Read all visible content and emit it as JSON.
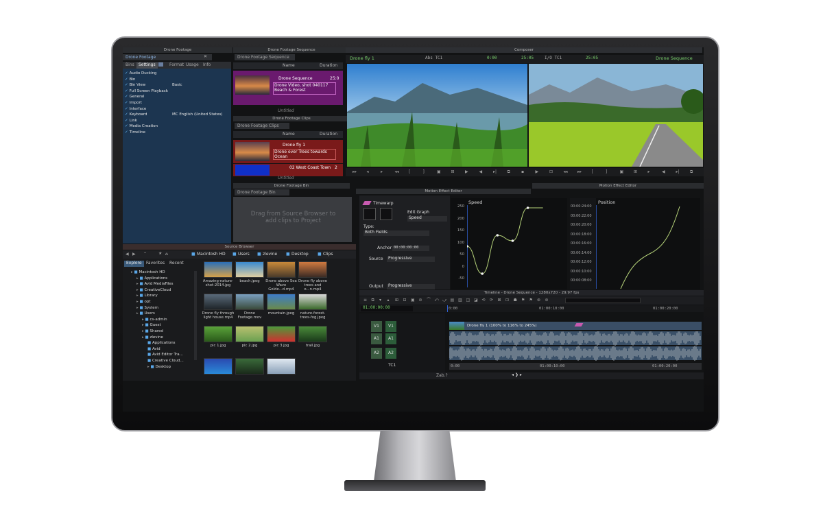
{
  "colors": {
    "bin_blue": "#1c3550",
    "purple_row": "#6a1a6e",
    "red_row": "#7a1a1a",
    "green_tc": "#7bd36e",
    "curve": "#b6d37a",
    "track_green": "#2f6a3e"
  },
  "bin_panel": {
    "window_title": "Drone Footage",
    "tab_label": "Drone Footage",
    "subtabs": [
      "Bins",
      "Settings",
      "",
      "Format",
      "Usage",
      "Info"
    ],
    "settings": [
      {
        "name": "Audio Ducking",
        "value": ""
      },
      {
        "name": "Bin",
        "value": ""
      },
      {
        "name": "Bin View",
        "value": "Basic"
      },
      {
        "name": "Full Screen Playback",
        "value": ""
      },
      {
        "name": "General",
        "value": ""
      },
      {
        "name": "Import",
        "value": ""
      },
      {
        "name": "Interface",
        "value": ""
      },
      {
        "name": "Keyboard",
        "value": "MC English (United States)"
      },
      {
        "name": "Link",
        "value": ""
      },
      {
        "name": "Media Creation",
        "value": ""
      },
      {
        "name": "Timeline",
        "value": ""
      }
    ]
  },
  "sequence_bin": {
    "window_title": "Drone Footage Sequence",
    "tab_label": "Drone Footage Sequence",
    "col_name": "Name",
    "col_duration": "Duration",
    "item_name": "Drone Sequence",
    "item_duration": "25:0",
    "item_comment": "Drone Video, shot 040117 Beach & Forest",
    "footer": "Untitled"
  },
  "clips_bin": {
    "window_title": "Drone Footage Clips",
    "tab_label": "Drone Footage Clips",
    "col_name": "Name",
    "col_duration": "Duration",
    "item1_name": "Drone fly 1",
    "item1_comment": "Drone over Trees towards Ocean",
    "item2_name": "02 West Coast Town",
    "item2_duration": "2",
    "footer": "Untitled"
  },
  "footage_bin": {
    "window_title": "Drone Footage Bin",
    "tab_label": "Drone Footage Bin",
    "empty_text": "Drag from Source Browser to add clips to Project"
  },
  "composer": {
    "title": "Composer",
    "source_clip": "Drone fly 1",
    "abs_label": "Abs TC1",
    "abs_value": "0:00",
    "dur1": "25:05",
    "io_label": "I/O TC1",
    "dur2": "25:05",
    "record_seq": "Drone Sequence"
  },
  "source_browser": {
    "title": "Source Browser",
    "path": [
      "Macintosh HD",
      "Users",
      "zlevine",
      "Desktop",
      "Clips"
    ],
    "tabs": [
      "Explore",
      "Favorites",
      "Recent"
    ],
    "tree": [
      {
        "name": "Macintosh HD",
        "level": 0
      },
      {
        "name": "Applications",
        "level": 1
      },
      {
        "name": "Avid MediaFiles",
        "level": 1
      },
      {
        "name": "CreativeCloud",
        "level": 1
      },
      {
        "name": "Library",
        "level": 1
      },
      {
        "name": "opt",
        "level": 1
      },
      {
        "name": "System",
        "level": 1
      },
      {
        "name": "Users",
        "level": 1
      },
      {
        "name": "cs-admin",
        "level": 2
      },
      {
        "name": "Guest",
        "level": 2
      },
      {
        "name": "Shared",
        "level": 2
      },
      {
        "name": "zlevine",
        "level": 2
      },
      {
        "name": "Applications",
        "level": 3
      },
      {
        "name": "Avid",
        "level": 3
      },
      {
        "name": "Avid Editor Tra...",
        "level": 3
      },
      {
        "name": "Creative Cloud...",
        "level": 3
      },
      {
        "name": "Desktop",
        "level": 3
      }
    ],
    "files": [
      {
        "name": "Amazing-nature-shot-2014.jpg",
        "c1": "#2a6fb8",
        "c2": "#d6a24a"
      },
      {
        "name": "beach.jpeg",
        "c1": "#3a8ad0",
        "c2": "#e0cfa0"
      },
      {
        "name": "Drone above Sea Wave Golde...d.mp4",
        "c1": "#c98a3a",
        "c2": "#4a3a2a"
      },
      {
        "name": "Drone fly above trees and o...n.mp4",
        "c1": "#d07a40",
        "c2": "#3b2a24"
      },
      {
        "name": "Drone fly through light house.mp4",
        "c1": "#5a6a7a",
        "c2": "#1e2428"
      },
      {
        "name": "Drone Footage.mov",
        "c1": "#7aa0c0",
        "c2": "#3a4a3a"
      },
      {
        "name": "mountain.jpeg",
        "c1": "#3d7cc9",
        "c2": "#6a8a4a"
      },
      {
        "name": "nature-forest-trees-fog.jpeg",
        "c1": "#d8d8d8",
        "c2": "#3a6a2a"
      },
      {
        "name": "pic 1.jpg",
        "c1": "#5aa23a",
        "c2": "#2a5a1a"
      },
      {
        "name": "pic 2.jpg",
        "c1": "#b8c070",
        "c2": "#6aa050"
      },
      {
        "name": "pic 3.jpg",
        "c1": "#4a9a3a",
        "c2": "#d03030"
      },
      {
        "name": "trail.jpg",
        "c1": "#4a8a3a",
        "c2": "#1a3a1a"
      },
      {
        "name": "",
        "c1": "#2a4ab0",
        "c2": "#2a8ad8"
      },
      {
        "name": "",
        "c1": "#3a6a3a",
        "c2": "#1a2a1a"
      },
      {
        "name": "",
        "c1": "#e0e8f0",
        "c2": "#8aa0b8"
      }
    ]
  },
  "motion_effect": {
    "title1": "Motion Effect Editor",
    "title2": "Motion Effect Editor",
    "timewarp": "Timewarp",
    "edit_graph": "Edit Graph",
    "edit_graph_value": "Speed",
    "type_label": "Type:",
    "type_value": "Both Fields",
    "anchor_label": "Anchor",
    "anchor_value": "00:00:00:00",
    "source_label": "Source",
    "source_value": "Progressive",
    "output_label": "Output",
    "output_value": "Progressive",
    "speed_graph": {
      "title": "Speed",
      "y_ticks": [
        "250",
        "200",
        "150",
        "100",
        "50",
        "0",
        "-50"
      ],
      "points": [
        [
          0,
          100
        ],
        [
          1,
          0
        ],
        [
          2,
          140
        ],
        [
          3,
          120
        ],
        [
          4,
          240
        ],
        [
          5,
          240
        ]
      ]
    },
    "position_graph": {
      "title": "Position",
      "ticks": [
        "00:00:24:00",
        "00:00:22:00",
        "00:00:20:00",
        "00:00:18:00",
        "00:00:16:00",
        "00:00:14:00",
        "00:00:12:00",
        "00:00:10:00",
        "00:00:08:00"
      ]
    }
  },
  "timeline": {
    "title": "Timeline - Drone Sequence - 1280x720 - 29.97 fps",
    "timecode": "01:00:00:00",
    "ruler": [
      "0:00",
      "01:00:10:00",
      "01:00:20:00"
    ],
    "ruler2": [
      "0:00",
      "01:00:10:00",
      "01:00:20:00"
    ],
    "tracks": [
      "V1",
      "A1",
      "A2",
      "TC1"
    ],
    "clip_label": "Drone fly 1 (100% to 116% to 245%)",
    "zoom": "Zab.?"
  }
}
